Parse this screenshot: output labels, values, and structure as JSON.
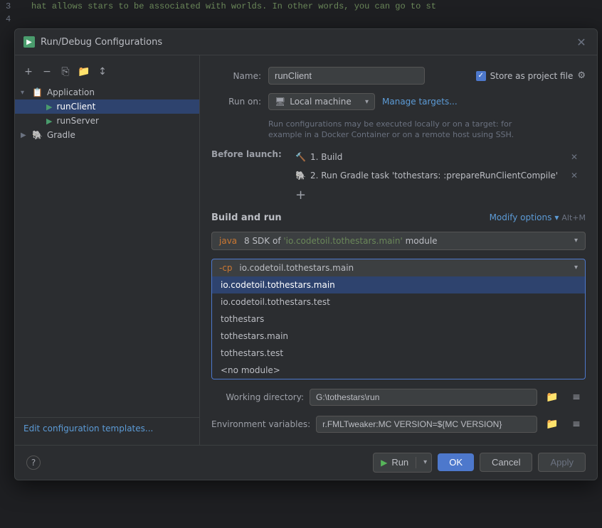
{
  "dialog": {
    "title": "Run/Debug Configurations",
    "icon_label": "▶",
    "close_label": "✕"
  },
  "toolbar": {
    "add_label": "+",
    "remove_label": "−",
    "copy_label": "⎘",
    "folder_label": "📁",
    "sort_label": "↕"
  },
  "tree": {
    "application_label": "Application",
    "run_client_label": "runClient",
    "run_server_label": "runServer",
    "gradle_label": "Gradle"
  },
  "edit_config_link": "Edit configuration templates...",
  "form": {
    "name_label": "Name:",
    "name_value": "runClient",
    "run_on_label": "Run on:",
    "local_machine_label": "Local machine",
    "manage_targets_label": "Manage targets...",
    "hint_line1": "Run configurations may be executed locally or on a target: for",
    "hint_line2": "example in a Docker Container or on a remote host using SSH.",
    "store_label": "Store as project file",
    "gear_symbol": "⚙",
    "before_launch_label": "Before launch:",
    "launch_item_1": "1. Build",
    "launch_item_2": "2. Run Gradle task 'tothestars: :prepareRunClientCompile'",
    "add_symbol": "+",
    "build_and_run_label": "Build and run",
    "modify_options_label": "Modify options",
    "modify_options_arrow": "▾",
    "modify_shortcut": "Alt+M",
    "java_sdk_value": "java 8 SDK of 'io.codetoil.tothestars.main' module",
    "cp_value": "-cp io.codetoil.tothestars.main",
    "dropdown_items": [
      "io.codetoil.tothestars.main",
      "io.codetoil.tothestars.test",
      "tothestars",
      "tothestars.main",
      "tothestars.test",
      "<no module>"
    ],
    "highlighted_item_index": 0,
    "working_directory_label": "Working directory:",
    "working_directory_value": "G:\\tothestars\\run",
    "env_variables_label": "Environment variables:",
    "env_variables_value": "r.FMLTweaker:MC VERSION=${MC VERSION}"
  },
  "footer": {
    "run_label": "Run",
    "ok_label": "OK",
    "cancel_label": "Cancel",
    "apply_label": "Apply"
  },
  "help_symbol": "?"
}
